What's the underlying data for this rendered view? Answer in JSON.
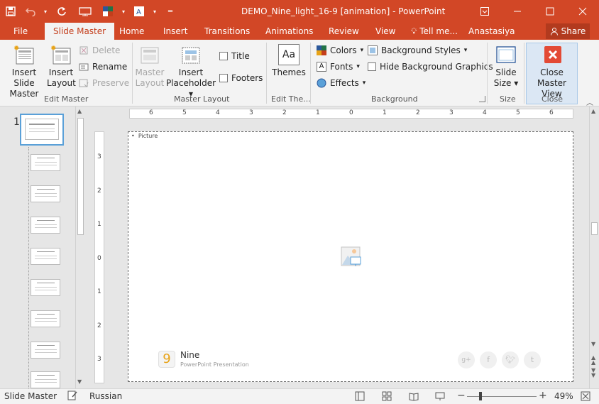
{
  "window": {
    "title": "DEMO_Nine_light_16-9 [animation] - PowerPoint"
  },
  "tabs": {
    "file": "File",
    "slide_master": "Slide Master",
    "home": "Home",
    "insert": "Insert",
    "transitions": "Transitions",
    "animations": "Animations",
    "review": "Review",
    "view": "View",
    "tell_me": "Tell me...",
    "user": "Anastasiya",
    "share": "Share"
  },
  "ribbon": {
    "edit_master": {
      "label": "Edit Master",
      "insert_slide_master": [
        "Insert Slide",
        "Master"
      ],
      "insert_layout": [
        "Insert",
        "Layout"
      ],
      "delete": "Delete",
      "rename": "Rename",
      "preserve": "Preserve"
    },
    "master_layout": {
      "label": "Master Layout",
      "master_layout_btn": [
        "Master",
        "Layout"
      ],
      "insert_placeholder": [
        "Insert",
        "Placeholder"
      ],
      "title": "Title",
      "footers": "Footers"
    },
    "edit_theme": {
      "label": "Edit The...",
      "themes": "Themes",
      "themes_glyph": "Aa"
    },
    "background": {
      "label": "Background",
      "colors": "Colors",
      "fonts": "Fonts",
      "fonts_glyph": "A",
      "effects": "Effects",
      "background_styles": "Background Styles",
      "hide_background_graphics": "Hide Background Graphics"
    },
    "size": {
      "label": "Size",
      "slide_size": [
        "Slide",
        "Size"
      ]
    },
    "close": {
      "label": "Close",
      "close_master_view": [
        "Close",
        "Master View"
      ]
    }
  },
  "thumbnails": {
    "first_index": "1"
  },
  "ruler": {
    "h_labels": [
      "6",
      "5",
      "4",
      "3",
      "2",
      "1",
      "0",
      "1",
      "2",
      "3",
      "4",
      "5",
      "6"
    ],
    "v_labels": [
      "3",
      "2",
      "1",
      "0",
      "1",
      "2",
      "3"
    ]
  },
  "slide": {
    "placeholder_label": "Picture",
    "brand_number": "9",
    "brand_name": "Nine",
    "brand_subtitle": "PowerPoint Presentation",
    "social_icons": [
      "g+",
      "f",
      "t",
      "tumblr"
    ]
  },
  "statusbar": {
    "mode": "Slide Master",
    "language": "Russian",
    "zoom": "49%"
  },
  "colors": {
    "accent": "#d24726",
    "ribbon_bg": "#f3f3f3",
    "close_icon": "#e34a35"
  }
}
